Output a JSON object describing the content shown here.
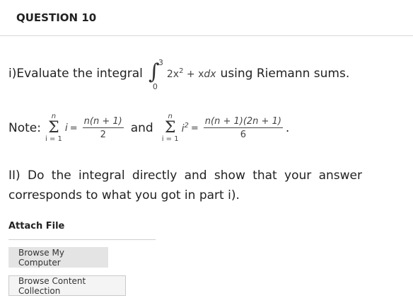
{
  "question": {
    "title": "QUESTION 10"
  },
  "part_i": {
    "prefix": "i)Evaluate the integral",
    "upper_limit": "3",
    "lower_limit": "0",
    "integrand": "2x",
    "integrand_exponent": "2",
    "integrand_rest": " + x",
    "differential": "dx",
    "suffix": "using Riemann sums."
  },
  "note": {
    "label": "Note:",
    "sum1": {
      "top": "n",
      "bottom": "i = 1",
      "term": "i",
      "numerator": "n(n + 1)",
      "denominator": "2"
    },
    "connector": "and",
    "sum2": {
      "top": "n",
      "bottom": "i = 1",
      "term": "i",
      "exponent": "2",
      "numerator": "n(n + 1)(2n + 1)",
      "denominator": "6"
    },
    "end": "."
  },
  "part_ii": {
    "text": "II) Do the integral directly and show that your answer corresponds to what you got in part i)."
  },
  "attach": {
    "label": "Attach File",
    "browse_computer": "Browse My Computer",
    "browse_collection": "Browse Content Collection"
  }
}
